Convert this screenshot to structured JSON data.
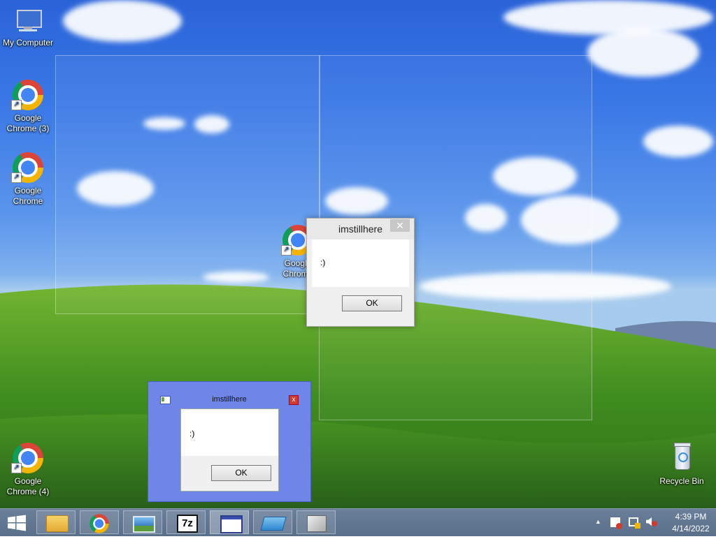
{
  "desktop": {
    "icons": [
      {
        "label": "My Computer"
      },
      {
        "label": "Google Chrome (3)"
      },
      {
        "label": "Google Chrome"
      },
      {
        "label": "Google Chrome"
      },
      {
        "label": "Google Chrome (4)"
      },
      {
        "label": "Recycle Bin"
      }
    ]
  },
  "dialog_modern": {
    "title": "imstillhere",
    "message": ":)",
    "ok_label": "OK",
    "close_glyph": "✕"
  },
  "dialog_classic": {
    "title": "imstillhere",
    "message": ":)",
    "ok_label": "OK",
    "close_glyph": "x"
  },
  "taskbar": {
    "apps": [
      {
        "icon": "file-explorer-icon"
      },
      {
        "icon": "chrome-icon"
      },
      {
        "icon": "photo-viewer-icon"
      },
      {
        "icon": "7zip-icon",
        "text": "7z"
      },
      {
        "icon": "window-app-icon",
        "active": true
      },
      {
        "icon": "folder-app-icon"
      },
      {
        "icon": "task-manager-icon"
      }
    ],
    "tray": {
      "chevron": "▲"
    },
    "clock": {
      "time": "4:39 PM",
      "date": "4/14/2022"
    }
  },
  "colors": {
    "accent": "#6f86e8",
    "taskbar": "#5f7490",
    "close_red": "#d23a2e"
  }
}
